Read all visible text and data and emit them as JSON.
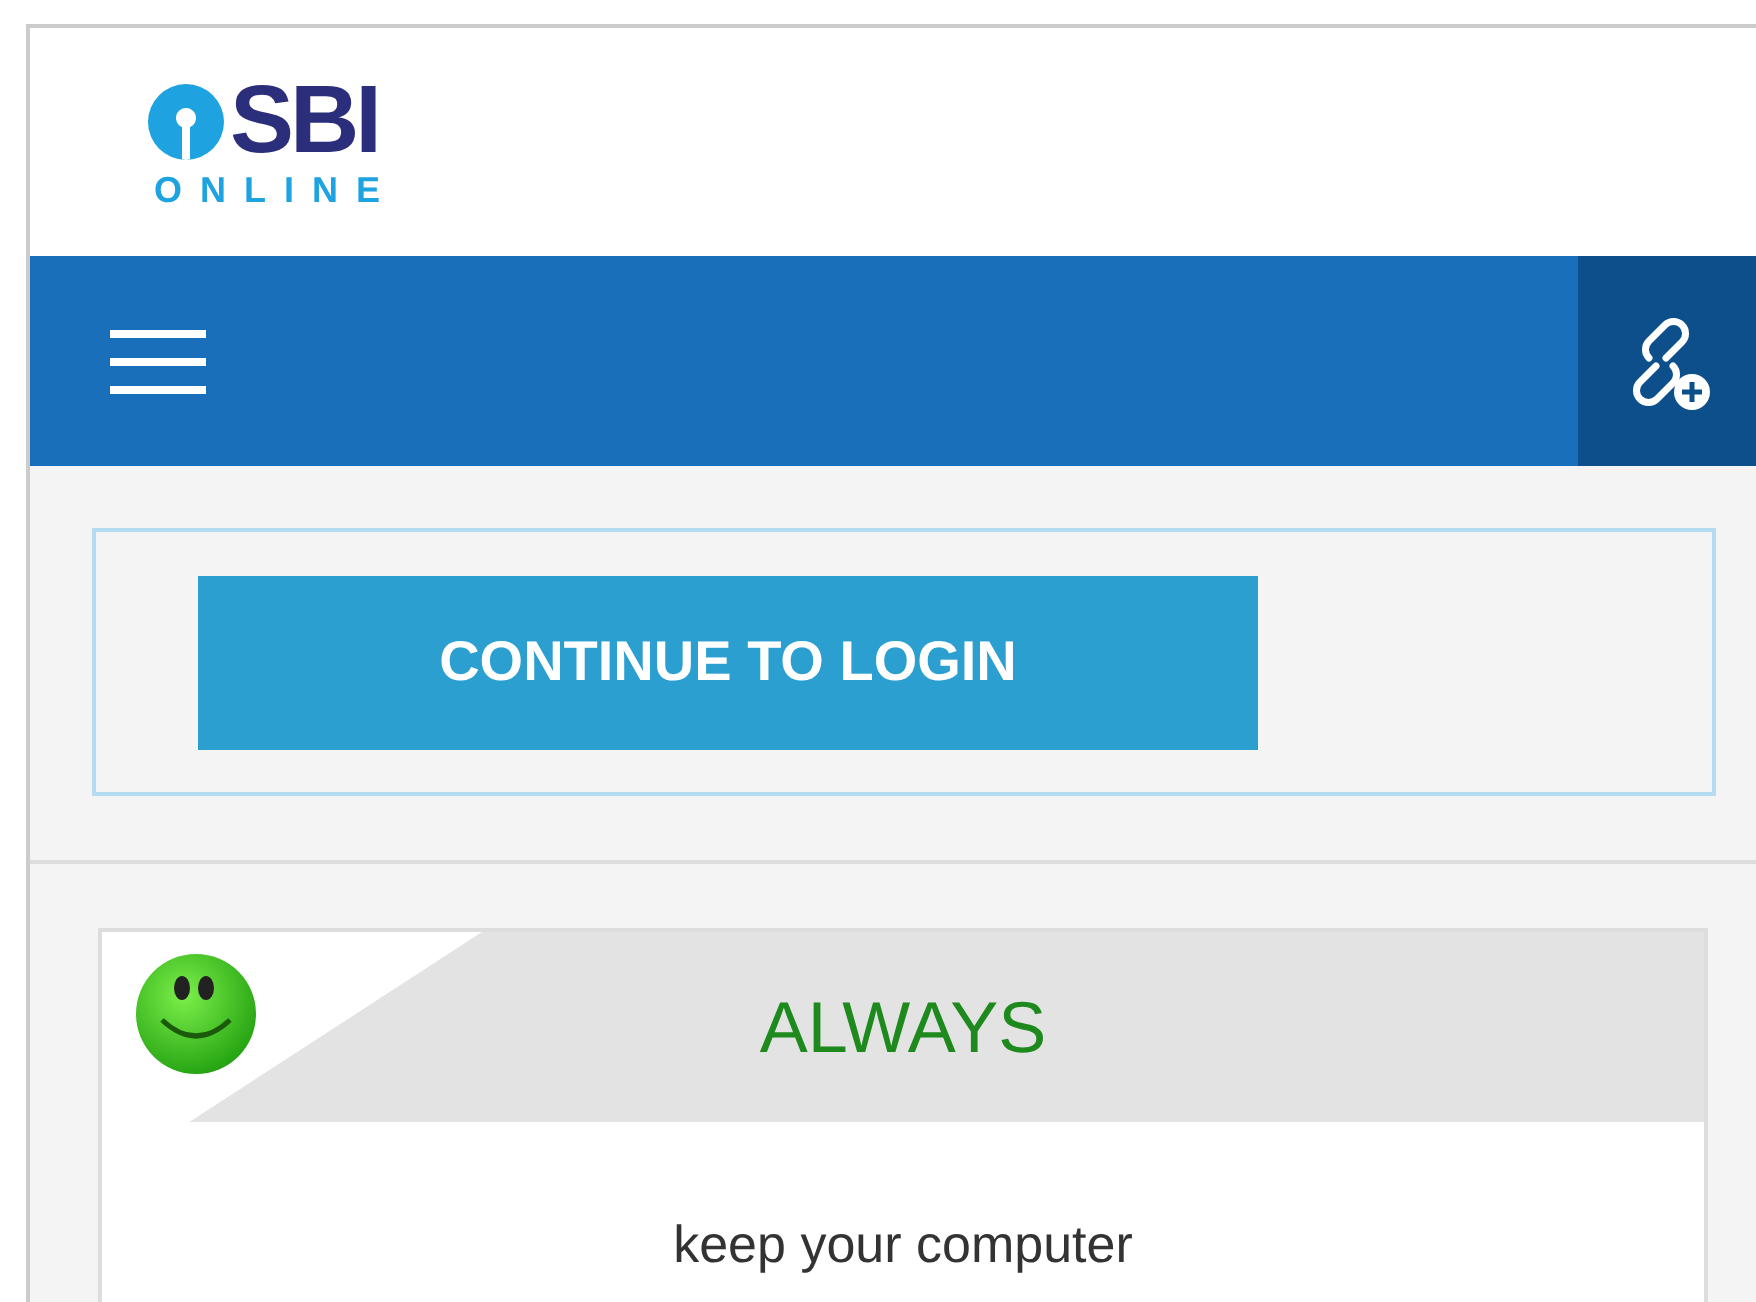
{
  "logo": {
    "name": "SBI",
    "tagline": "ONLINE"
  },
  "login_button": "CONTINUE TO LOGIN",
  "tip_card": {
    "title": "ALWAYS",
    "text": "keep your computer"
  }
}
